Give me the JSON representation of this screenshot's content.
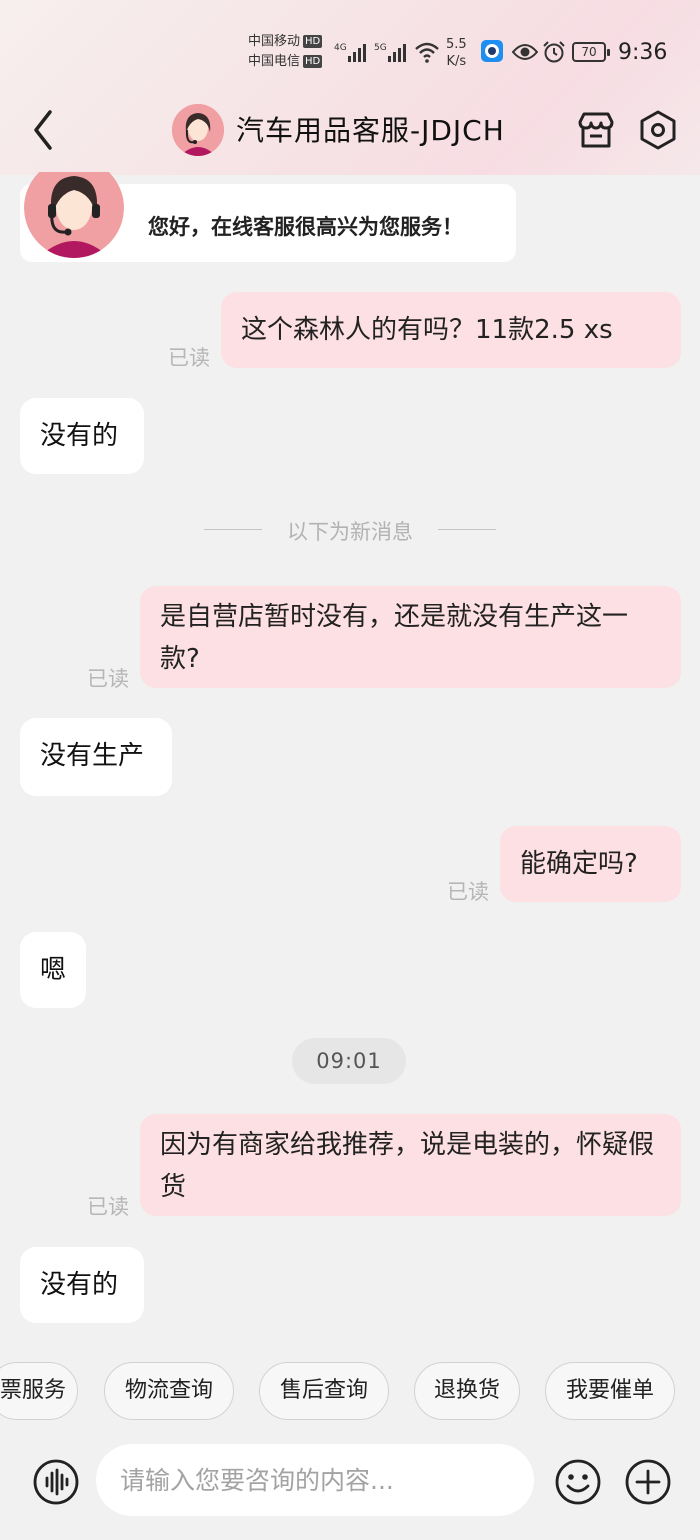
{
  "status_bar": {
    "carrier1": "中国移动",
    "carrier2": "中国电信",
    "hd": "HD",
    "net1": "4G",
    "net2": "5G",
    "speed_value": "5.5",
    "speed_unit": "K/s",
    "battery": "70",
    "time": "9:36"
  },
  "header": {
    "title": "汽车用品客服-JDJCH"
  },
  "messages": {
    "greeting": "您好，在线客服很高兴为您服务！",
    "m1": "这个森林人的有吗？11款2.5 xs",
    "m2": "没有的",
    "divider": "以下为新消息",
    "m3": "是自营店暂时没有，还是就没有生产这一款?",
    "m4": "没有生产",
    "m5": "能确定吗?",
    "m6": "嗯",
    "timestamp": "09:01",
    "m7": "因为有商家给我推荐，说是电装的，怀疑假货",
    "m8": "没有的",
    "read_label": "已读"
  },
  "quick_actions": [
    "票服务",
    "物流查询",
    "售后查询",
    "退换货",
    "我要催单"
  ],
  "input": {
    "placeholder": "请输入您要咨询的内容..."
  },
  "colors": {
    "my_bubble": "#fde0e3",
    "their_bubble": "#ffffff",
    "background": "#f1f1f1"
  },
  "icons": [
    "back-arrow-icon",
    "store-icon",
    "settings-hexagon-icon",
    "voice-icon",
    "emoji-icon",
    "plus-icon"
  ]
}
